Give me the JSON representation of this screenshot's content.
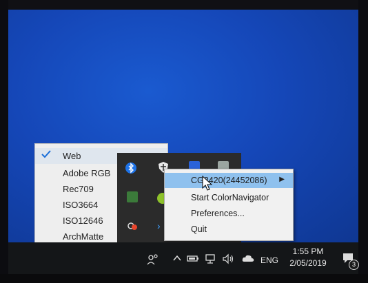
{
  "color_space_menu": {
    "items": [
      {
        "label": "Web",
        "checked": true
      },
      {
        "label": "Adobe RGB",
        "checked": false
      },
      {
        "label": "Rec709",
        "checked": false
      },
      {
        "label": "ISO3664",
        "checked": false
      },
      {
        "label": "ISO12646",
        "checked": false
      },
      {
        "label": "ArchMatte",
        "checked": false
      }
    ]
  },
  "context_menu": {
    "items": [
      {
        "label": "CG2420(24452086)",
        "has_submenu": true,
        "highlighted": true
      },
      {
        "label": "Start ColorNavigator",
        "has_submenu": false
      },
      {
        "label": "Preferences...",
        "has_submenu": false
      },
      {
        "label": "Quit",
        "has_submenu": false
      }
    ]
  },
  "taskbar": {
    "language": "ENG",
    "time": "1:55 PM",
    "date": "2/05/2019",
    "notification_count": "3"
  },
  "colors": {
    "desktop": "#1547b8",
    "taskbar": "#141618",
    "menu_highlight": "#8fc1ee",
    "check_accent": "#1a6ed8"
  }
}
